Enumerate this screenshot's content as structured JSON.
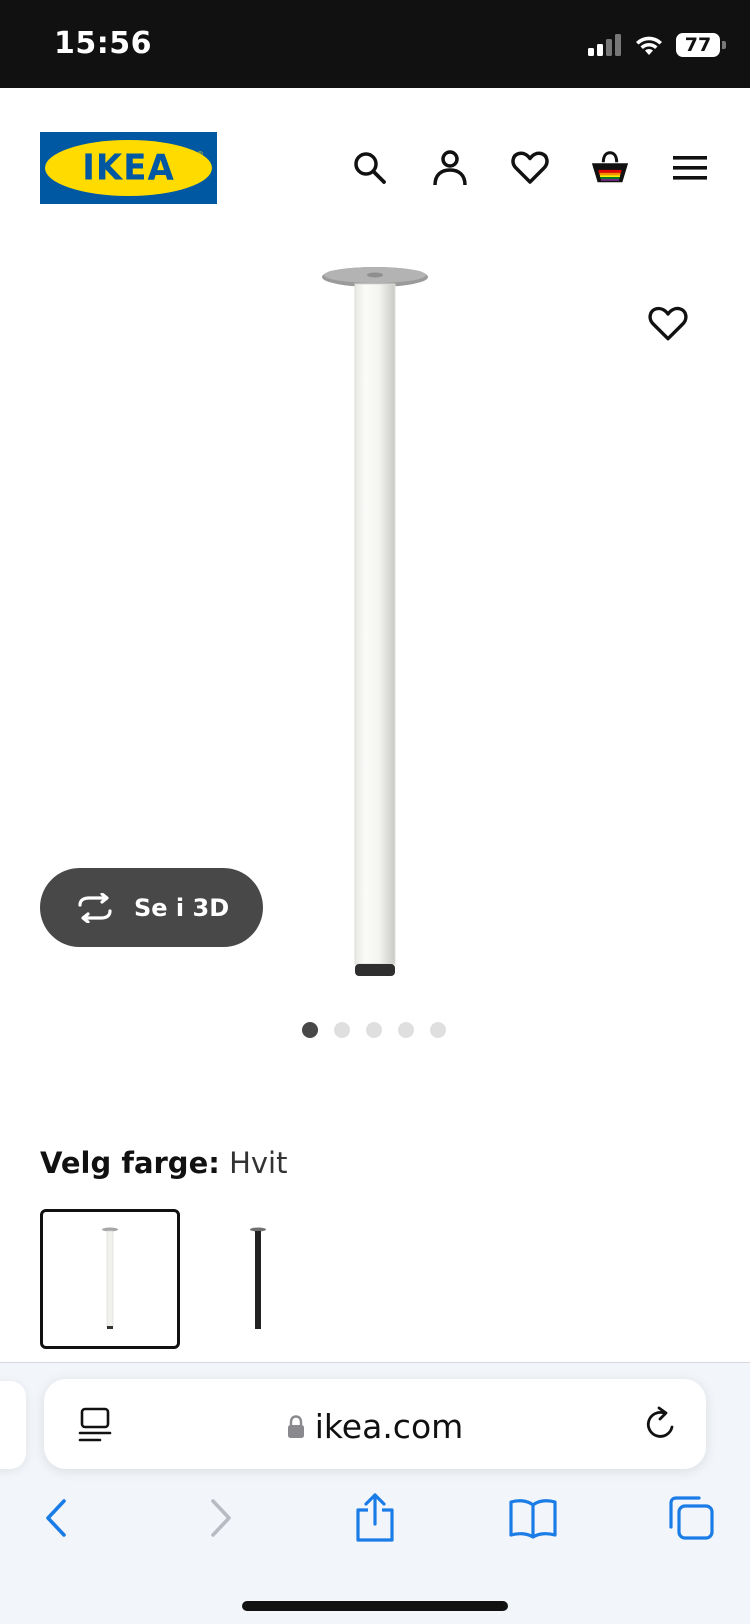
{
  "status_bar": {
    "time": "15:56",
    "battery": "77"
  },
  "header": {
    "logo_text": "IKEA",
    "icons": [
      "search-icon",
      "account-icon",
      "heart-icon",
      "basket-icon",
      "menu-icon"
    ]
  },
  "gallery": {
    "view_3d_label": "Se i 3D",
    "image_count": 5,
    "active_image": 1
  },
  "color_picker": {
    "label": "Velg farge:",
    "selected_value": "Hvit",
    "options": [
      "white",
      "black"
    ]
  },
  "browser": {
    "url": "ikea.com"
  },
  "colors": {
    "ikea_blue": "#0058a3",
    "ikea_yellow": "#ffdb00",
    "dark_button": "#484848",
    "safari_blue": "#1a7ce6"
  }
}
